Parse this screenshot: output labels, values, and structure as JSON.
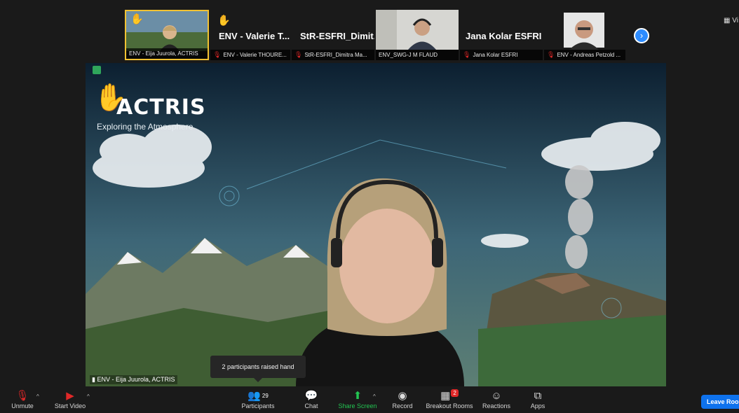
{
  "gallery": {
    "tiles": [
      {
        "caption": "ENV - Eija Juurola, ACTRIS",
        "big_name": "",
        "raised_hand": true,
        "video": true
      },
      {
        "caption": "ENV - Valerie THOURE...",
        "big_name": "ENV - Valerie T...",
        "raised_hand": true,
        "video": false
      },
      {
        "caption": "StR-ESFRI_Dimitra Ma...",
        "big_name": "StR-ESFRI_Dimit...",
        "raised_hand": false,
        "video": false
      },
      {
        "caption": "ENV_SWG-J M FLAUD",
        "big_name": "",
        "raised_hand": false,
        "video": true
      },
      {
        "caption": "Jana Kolar ESFRI",
        "big_name": "Jana Kolar ESFRI",
        "raised_hand": false,
        "video": false
      },
      {
        "caption": "ENV - Andreas Petzold ...",
        "big_name": "",
        "raised_hand": false,
        "video": true
      }
    ],
    "next_icon": "chevron-right-icon",
    "view_label": "Vi"
  },
  "main_video": {
    "speaker_label": "ENV - Eija Juurola, ACTRIS",
    "logo_name": "ACTRIS",
    "logo_tagline": "Exploring the Atmosphere"
  },
  "notification": {
    "text": "2 participants raised hand"
  },
  "toolbar": {
    "unmute": "Unmute",
    "start_video": "Start Video",
    "participants": "Participants",
    "participants_count": "29",
    "chat": "Chat",
    "share_screen": "Share Screen",
    "record": "Record",
    "breakout_rooms": "Breakout Rooms",
    "breakout_badge": "2",
    "reactions": "Reactions",
    "apps": "Apps",
    "leave": "Leave Room"
  },
  "colors": {
    "accent_blue": "#0e72ed",
    "share_green": "#23c552",
    "muted_red": "#e02828",
    "raised_hand": "#f4c02b",
    "active_border": "#f1c232"
  }
}
